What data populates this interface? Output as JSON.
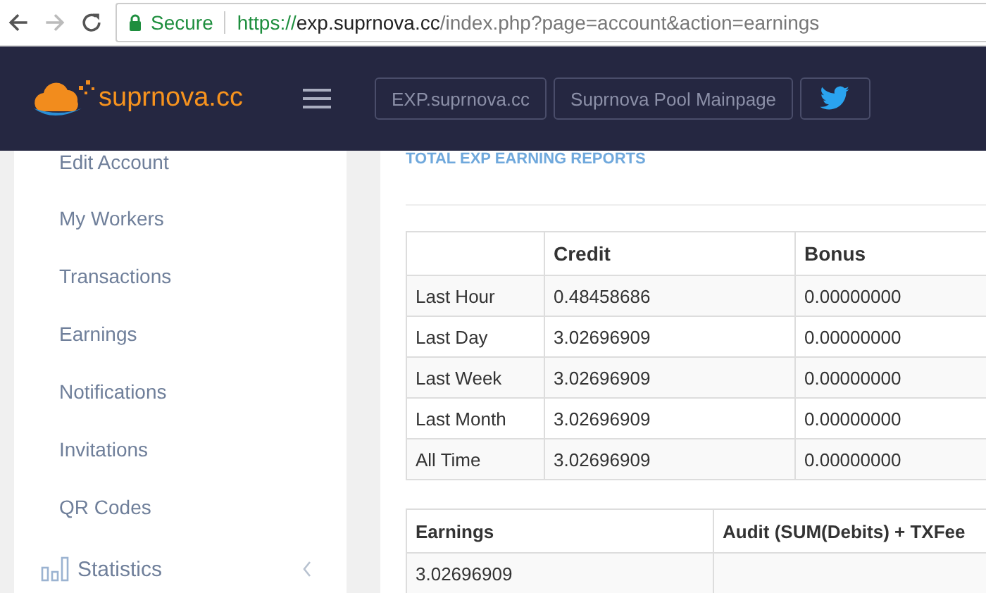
{
  "browser": {
    "back_enabled": true,
    "forward_enabled": false,
    "secure_label": "Secure",
    "scheme": "https://",
    "host": "exp.suprnova.cc",
    "path": "/index.php?page=account&action=earnings"
  },
  "navbar": {
    "logo_text": "suprnova.cc",
    "buttons": [
      {
        "kind": "text",
        "label": "EXP.suprnova.cc"
      },
      {
        "kind": "text",
        "label": "Suprnova Pool Mainpage"
      },
      {
        "kind": "twitter"
      }
    ]
  },
  "sidebar": {
    "items": [
      "Edit Account",
      "My Workers",
      "Transactions",
      "Earnings",
      "Notifications",
      "Invitations",
      "QR Codes"
    ],
    "section": {
      "label": "Statistics",
      "expanded": false
    }
  },
  "report": {
    "title": "TOTAL EXP EARNING REPORTS",
    "table": {
      "columns": [
        "",
        "Credit",
        "Bonus"
      ],
      "rows": [
        [
          "Last Hour",
          "0.48458686",
          "0.00000000"
        ],
        [
          "Last Day",
          "3.02696909",
          "0.00000000"
        ],
        [
          "Last Week",
          "3.02696909",
          "0.00000000"
        ],
        [
          "Last Month",
          "3.02696909",
          "0.00000000"
        ],
        [
          "All Time",
          "3.02696909",
          "0.00000000"
        ]
      ]
    },
    "audit_table": {
      "columns": [
        "Earnings",
        "Audit (SUM(Debits) + TXFee"
      ],
      "rows": [
        [
          "3.02696909",
          ""
        ]
      ]
    }
  }
}
